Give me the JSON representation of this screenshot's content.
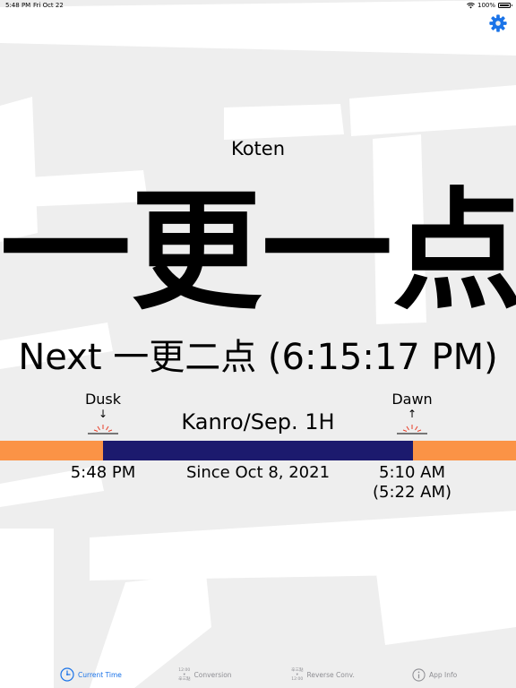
{
  "status_bar": {
    "time": "5:48 PM",
    "date": "Fri Oct 22",
    "battery": "100%"
  },
  "header": {
    "settings_icon": "gear-icon"
  },
  "main": {
    "era": "Koten",
    "current_hour": "一更一点",
    "next_hour": "Next 一更二点 (6:15:17 PM)",
    "season": "Kanro/Sep. 1H",
    "dusk": {
      "label": "Dusk",
      "arrow": "↓",
      "time": "5:48 PM"
    },
    "dawn": {
      "label": "Dawn",
      "arrow": "↑",
      "time": "5:10 AM",
      "time_alt": "(5:22 AM)"
    },
    "since": "Since Oct 8, 2021",
    "night_fraction": {
      "start": 0.2,
      "end": 0.8
    }
  },
  "colors": {
    "day": "#fb9346",
    "night": "#1c1a6e",
    "accent": "#1a73e8",
    "sun_rays": "#e8402b"
  },
  "tabs": [
    {
      "label": "Current Time",
      "icon": "clock-icon",
      "active": true
    },
    {
      "label": "Conversion",
      "icon": "conversion-icon",
      "icon_text": [
        "12:00",
        "▾",
        "辛三點"
      ],
      "active": false
    },
    {
      "label": "Reverse Conv.",
      "icon": "reverse-conversion-icon",
      "icon_text": [
        "辛三點",
        "▾",
        "12:00"
      ],
      "active": false
    },
    {
      "label": "App Info",
      "icon": "info-icon",
      "active": false
    }
  ]
}
